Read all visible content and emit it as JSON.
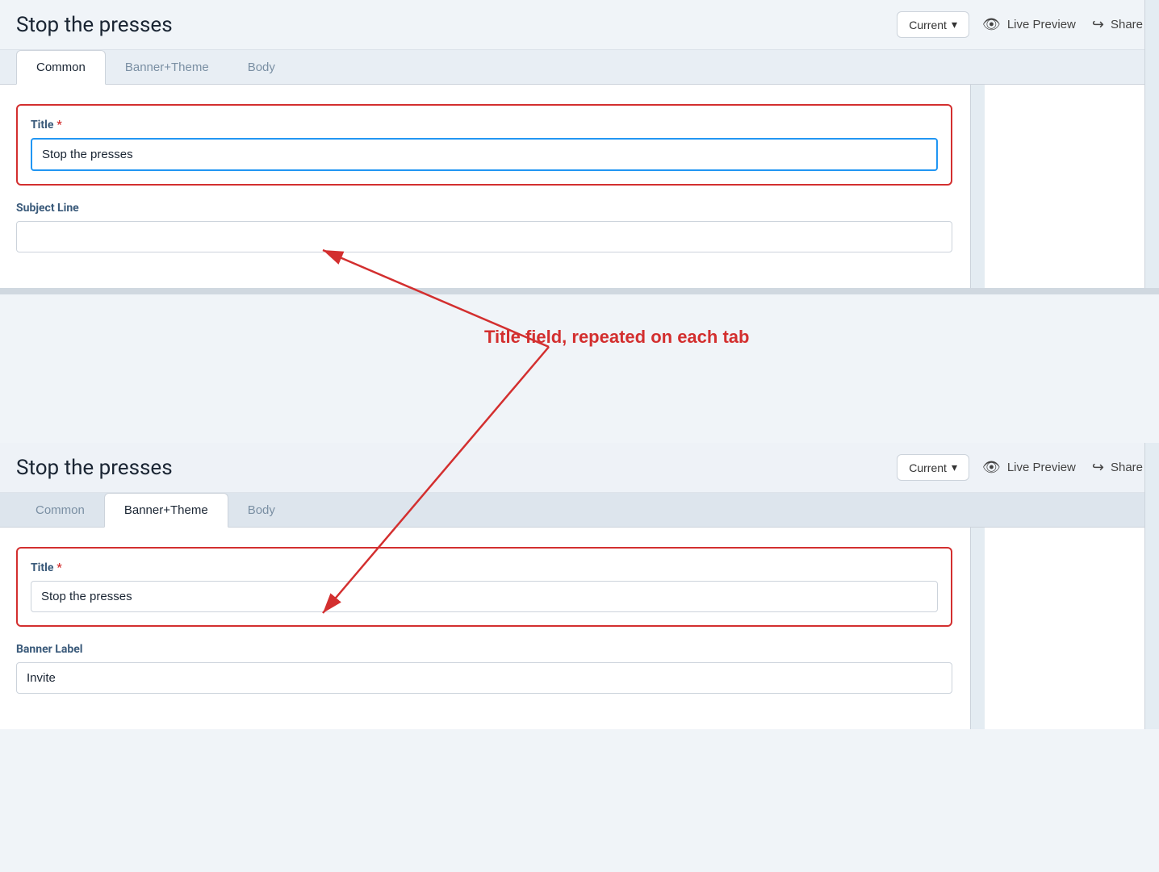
{
  "app": {
    "title": "Stop the presses",
    "version_label": "Current",
    "version_chevron": "▾"
  },
  "header": {
    "title": "Stop the presses",
    "version": {
      "label": "Current",
      "chevron": "▾"
    },
    "live_preview": "Live Preview",
    "share": "Share"
  },
  "tabs": {
    "top_panel": [
      {
        "label": "Common",
        "active": true
      },
      {
        "label": "Banner+Theme",
        "active": false
      },
      {
        "label": "Body",
        "active": false
      }
    ],
    "bottom_panel": [
      {
        "label": "Common",
        "active": false
      },
      {
        "label": "Banner+Theme",
        "active": true
      },
      {
        "label": "Body",
        "active": false
      }
    ]
  },
  "top_panel": {
    "title_label": "Title",
    "title_required": "*",
    "title_value": "Stop the presses",
    "subject_line_label": "Subject Line",
    "subject_line_value": ""
  },
  "bottom_panel": {
    "title_label": "Title",
    "title_required": "*",
    "title_value": "Stop the presses",
    "banner_label_label": "Banner Label",
    "banner_label_value": "Invite"
  },
  "annotation": {
    "text": "Title field, repeated on each tab"
  },
  "icons": {
    "eye": "👁",
    "share": "↪"
  }
}
